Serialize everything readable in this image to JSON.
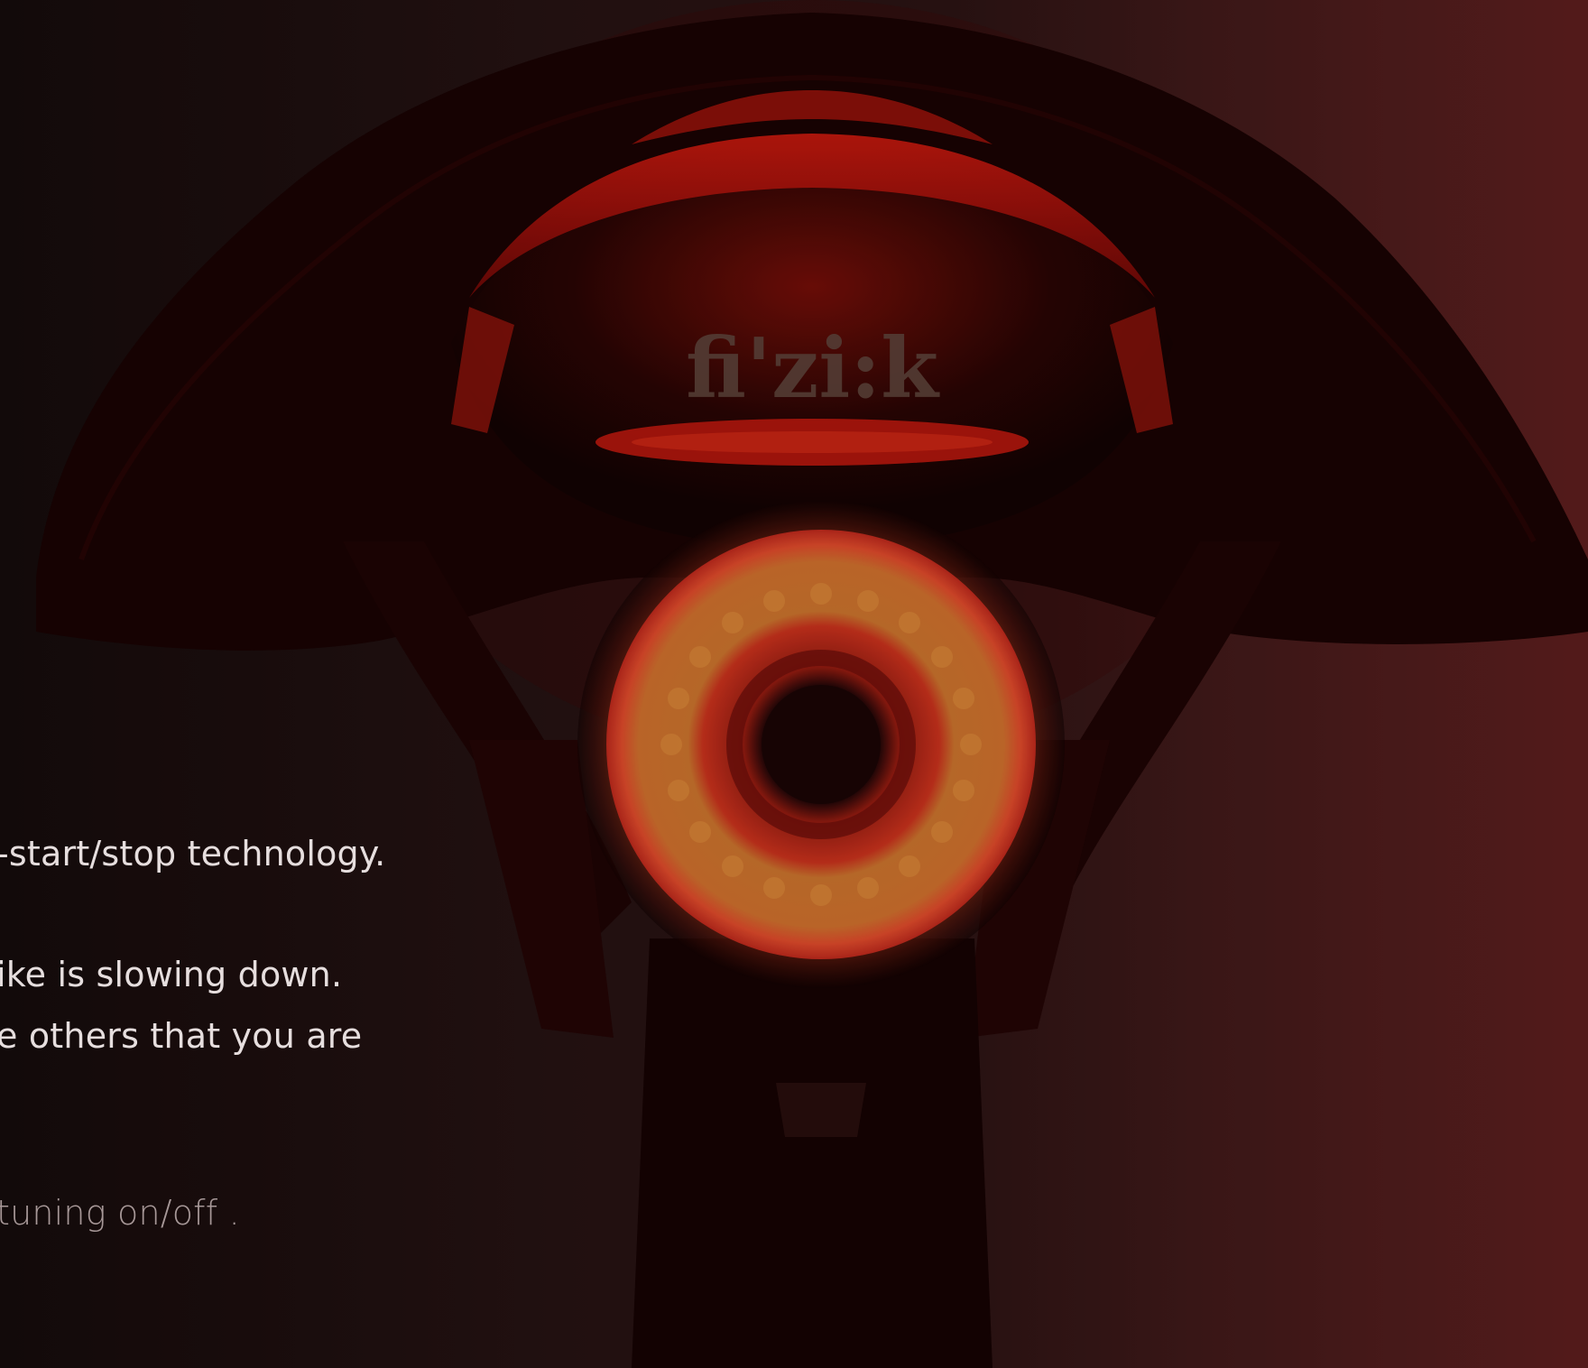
{
  "image": {
    "subject": "bicycle-tail-light",
    "saddle_logo": "fi'zi:k",
    "colors": {
      "background_left": "#140b0b",
      "background_right": "#5a1d1d",
      "light_ring_outer": "#e2502a",
      "light_ring_inner": "#c9672a",
      "saddle_glow": "#c21a10",
      "text_primary": "#e6dede",
      "text_muted": "#a79898"
    }
  },
  "copy": {
    "line_1": "-start/stop technology.",
    "line_2": "ike is slowing down.",
    "line_3": "e others that you are",
    "line_4": "tuning on/off ."
  }
}
